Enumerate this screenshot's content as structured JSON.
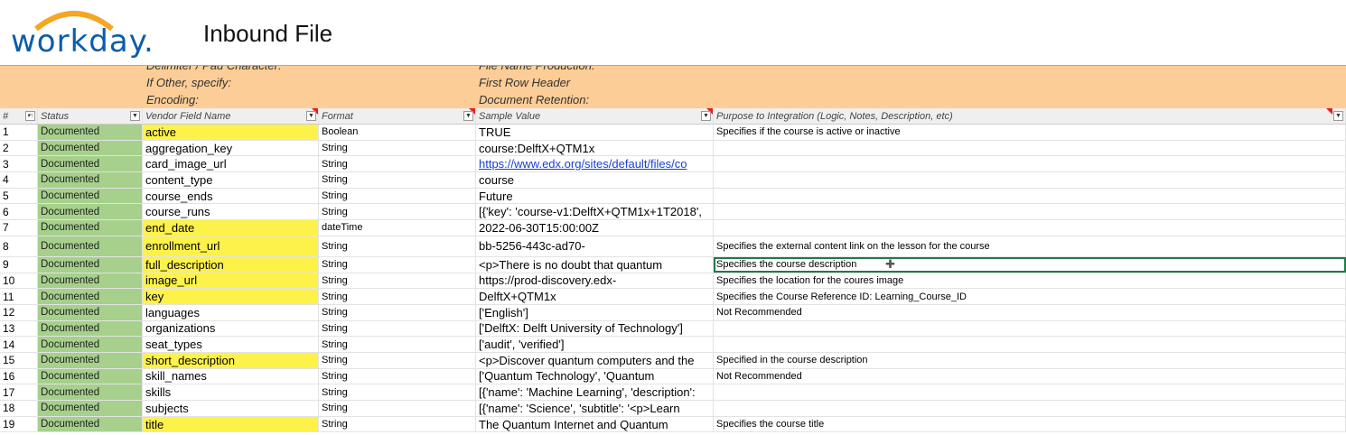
{
  "header": {
    "logo": "workday.",
    "title": "Inbound File"
  },
  "banner": {
    "left": [
      "Delimiter / Pad Character:",
      "If Other, specify:",
      "Encoding:"
    ],
    "right": [
      "File Name Production:",
      "First Row Header",
      "Document Retention:"
    ]
  },
  "columns": [
    "#",
    "Status",
    "Vendor Field Name",
    "Format",
    "Sample Value",
    "Purpose to Integration (Logic, Notes, Description, etc)"
  ],
  "rows": [
    {
      "n": "1",
      "status": "Documented",
      "field": "active",
      "hl": true,
      "format": "Boolean",
      "sample": "TRUE",
      "purpose": "Specifies if the course is active or inactive"
    },
    {
      "n": "2",
      "status": "Documented",
      "field": "aggregation_key",
      "hl": false,
      "format": "String",
      "sample": "course:DelftX+QTM1x",
      "purpose": ""
    },
    {
      "n": "3",
      "status": "Documented",
      "field": "card_image_url",
      "hl": false,
      "format": "String",
      "sample": "https://www.edx.org/sites/default/files/co",
      "purpose": ""
    },
    {
      "n": "4",
      "status": "Documented",
      "field": "content_type",
      "hl": false,
      "format": "String",
      "sample": "course",
      "purpose": ""
    },
    {
      "n": "5",
      "status": "Documented",
      "field": "course_ends",
      "hl": false,
      "format": "String",
      "sample": "Future",
      "purpose": ""
    },
    {
      "n": "6",
      "status": "Documented",
      "field": "course_runs",
      "hl": false,
      "format": "String",
      "sample": "[{'key': 'course-v1:DelftX+QTM1x+1T2018',",
      "purpose": ""
    },
    {
      "n": "7",
      "status": "Documented",
      "field": "end_date",
      "hl": true,
      "format": "dateTime",
      "sample": "2022-06-30T15:00:00Z",
      "purpose": ""
    },
    {
      "n": "8",
      "status": "Documented",
      "field": "enrollment_url",
      "hl": true,
      "format": "String",
      "sample": "bb-5256-443c-ad70-",
      "purpose": "Specifies the external content link on the lesson for the course"
    },
    {
      "n": "9",
      "status": "Documented",
      "field": "full_description",
      "hl": true,
      "format": "String",
      "sample": "<p>There is no doubt that quantum",
      "purpose": "Specifies the course description"
    },
    {
      "n": "10",
      "status": "Documented",
      "field": "image_url",
      "hl": true,
      "format": "String",
      "sample": "https://prod-discovery.edx-",
      "purpose": "Specifies the location for the coures image"
    },
    {
      "n": "11",
      "status": "Documented",
      "field": "key",
      "hl": true,
      "format": "String",
      "sample": "DelftX+QTM1x",
      "purpose": "Specifies the Course Reference ID: Learning_Course_ID"
    },
    {
      "n": "12",
      "status": "Documented",
      "field": "languages",
      "hl": false,
      "format": "String",
      "sample": "['English']",
      "purpose": "Not Recommended"
    },
    {
      "n": "13",
      "status": "Documented",
      "field": "organizations",
      "hl": false,
      "format": "String",
      "sample": "['DelftX: Delft University of Technology']",
      "purpose": ""
    },
    {
      "n": "14",
      "status": "Documented",
      "field": "seat_types",
      "hl": false,
      "format": "String",
      "sample": "['audit', 'verified']",
      "purpose": ""
    },
    {
      "n": "15",
      "status": "Documented",
      "field": "short_description",
      "hl": true,
      "format": "String",
      "sample": "<p>Discover quantum computers and the",
      "purpose": "Specified in the course description"
    },
    {
      "n": "16",
      "status": "Documented",
      "field": "skill_names",
      "hl": false,
      "format": "String",
      "sample": "['Quantum Technology', 'Quantum",
      "purpose": "Not Recommended"
    },
    {
      "n": "17",
      "status": "Documented",
      "field": "skills",
      "hl": false,
      "format": "String",
      "sample": "[{'name': 'Machine Learning', 'description':",
      "purpose": ""
    },
    {
      "n": "18",
      "status": "Documented",
      "field": "subjects",
      "hl": false,
      "format": "String",
      "sample": "[{'name': 'Science', 'subtitle': '<p>Learn",
      "purpose": ""
    },
    {
      "n": "19",
      "status": "Documented",
      "field": "title",
      "hl": true,
      "format": "String",
      "sample": "The Quantum Internet and Quantum",
      "purpose": "Specifies the course title"
    }
  ]
}
